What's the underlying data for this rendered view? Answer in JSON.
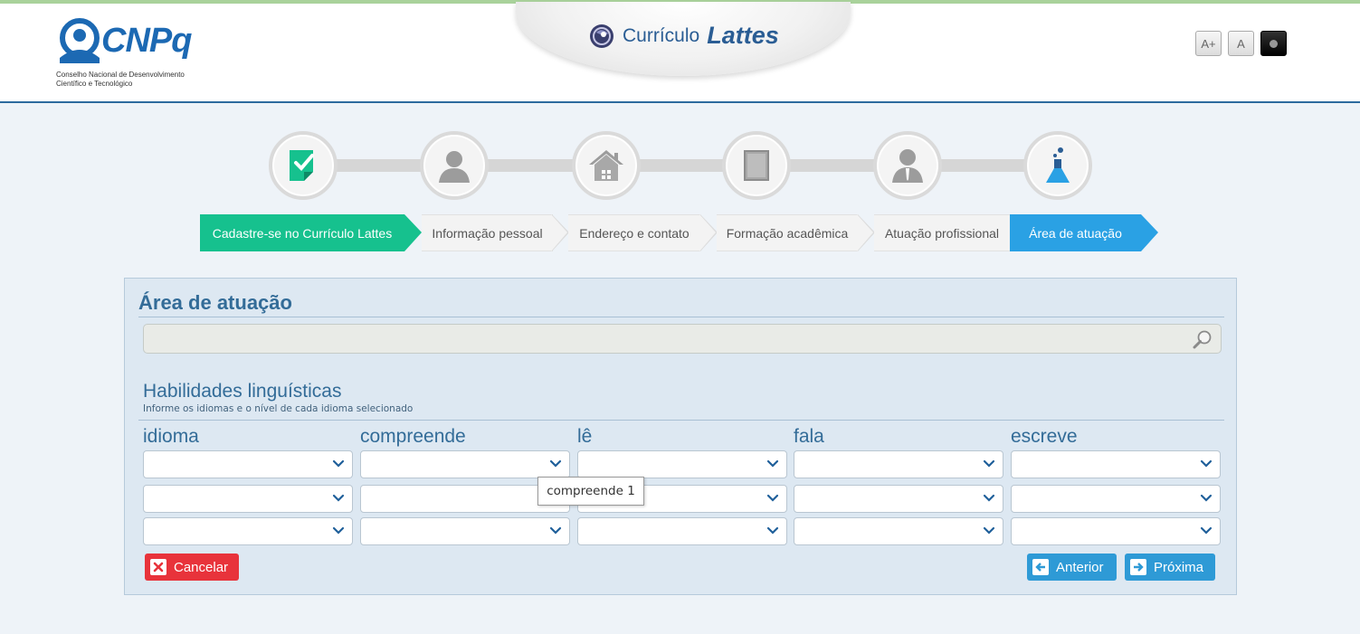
{
  "header": {
    "brand": "CNPq",
    "brand_subtitle_line1": "Conselho Nacional de Desenvolvimento",
    "brand_subtitle_line2": "Científico e Tecnológico",
    "app_title_prefix": "Currículo",
    "app_title_main": "Lattes",
    "accessibility": {
      "increase_font": "A+",
      "normal_font": "A"
    }
  },
  "steps": [
    {
      "icon": "clipboard-check-icon"
    },
    {
      "icon": "person-icon"
    },
    {
      "icon": "house-icon"
    },
    {
      "icon": "book-icon"
    },
    {
      "icon": "professional-icon"
    },
    {
      "icon": "flask-icon"
    }
  ],
  "breadcrumb": [
    {
      "label": "Cadastre-se no Currículo Lattes",
      "state": "done"
    },
    {
      "label": "Informação pessoal",
      "state": "pending"
    },
    {
      "label": "Endereço e contato",
      "state": "pending"
    },
    {
      "label": "Formação acadêmica",
      "state": "pending"
    },
    {
      "label": "Atuação profissional",
      "state": "pending"
    },
    {
      "label": "Área de atuação",
      "state": "current"
    }
  ],
  "colors": {
    "done": "#16c18e",
    "current": "#2aa1e4",
    "title": "#336c98",
    "cancel": "#e8333b"
  },
  "panel": {
    "title": "Área de atuação",
    "search": {
      "value": "",
      "placeholder": ""
    },
    "languages": {
      "title": "Habilidades linguísticas",
      "subtitle": "Informe os idiomas e o nível de cada idioma selecionado",
      "columns": [
        "idioma",
        "compreende",
        "lê",
        "fala",
        "escreve"
      ]
    },
    "tooltip": "compreende 1",
    "buttons": {
      "cancel": "Cancelar",
      "previous": "Anterior",
      "next": "Próxima"
    }
  }
}
